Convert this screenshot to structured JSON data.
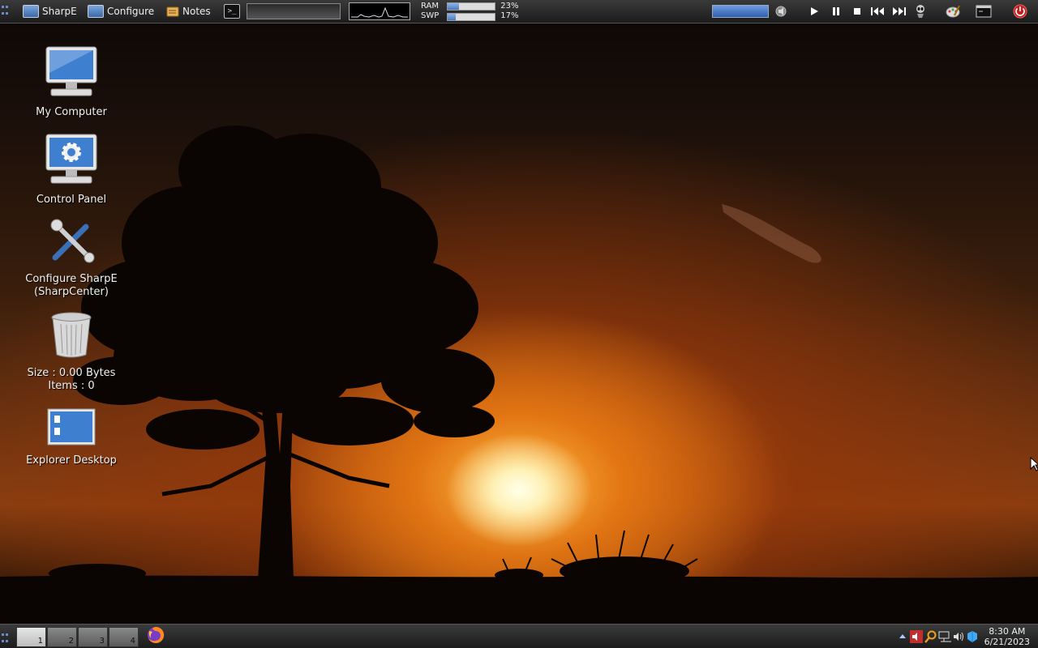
{
  "topbar": {
    "sharpe_label": "SharpE",
    "configure_label": "Configure",
    "notes_label": "Notes",
    "terminal_glyph": ">_",
    "ram_label": "RAM",
    "swp_label": "SWP",
    "ram_value": "23%",
    "swp_value": "17%",
    "ram_fraction": 0.23,
    "swp_fraction": 0.17
  },
  "desktop_icons": {
    "my_computer": "My Computer",
    "control_panel": "Control Panel",
    "configure_line1": "Configure SharpE",
    "configure_line2": "(SharpCenter)",
    "recycle_line1": "Size : 0.00 Bytes",
    "recycle_line2": "Items : 0",
    "explorer_desktop": "Explorer Desktop"
  },
  "taskbar": {
    "workspaces": [
      "1",
      "2",
      "3",
      "4"
    ],
    "active_workspace": "1",
    "clock_time": "8:30 AM",
    "clock_date": "6/21/2023"
  },
  "colors": {
    "accent": "#4a78c0",
    "power": "#e03030"
  },
  "icons": [
    "grid-menu-icon",
    "monitor-icon",
    "notes-icon",
    "terminal-icon",
    "play-icon",
    "pause-icon",
    "stop-icon",
    "previous-icon",
    "next-icon",
    "alien-icon",
    "paint-icon",
    "console-icon",
    "power-icon",
    "firefox-icon",
    "tray-arrow-icon",
    "speaker-muted-icon",
    "search-icon",
    "network-icon",
    "volume-icon",
    "dropbox-icon"
  ]
}
